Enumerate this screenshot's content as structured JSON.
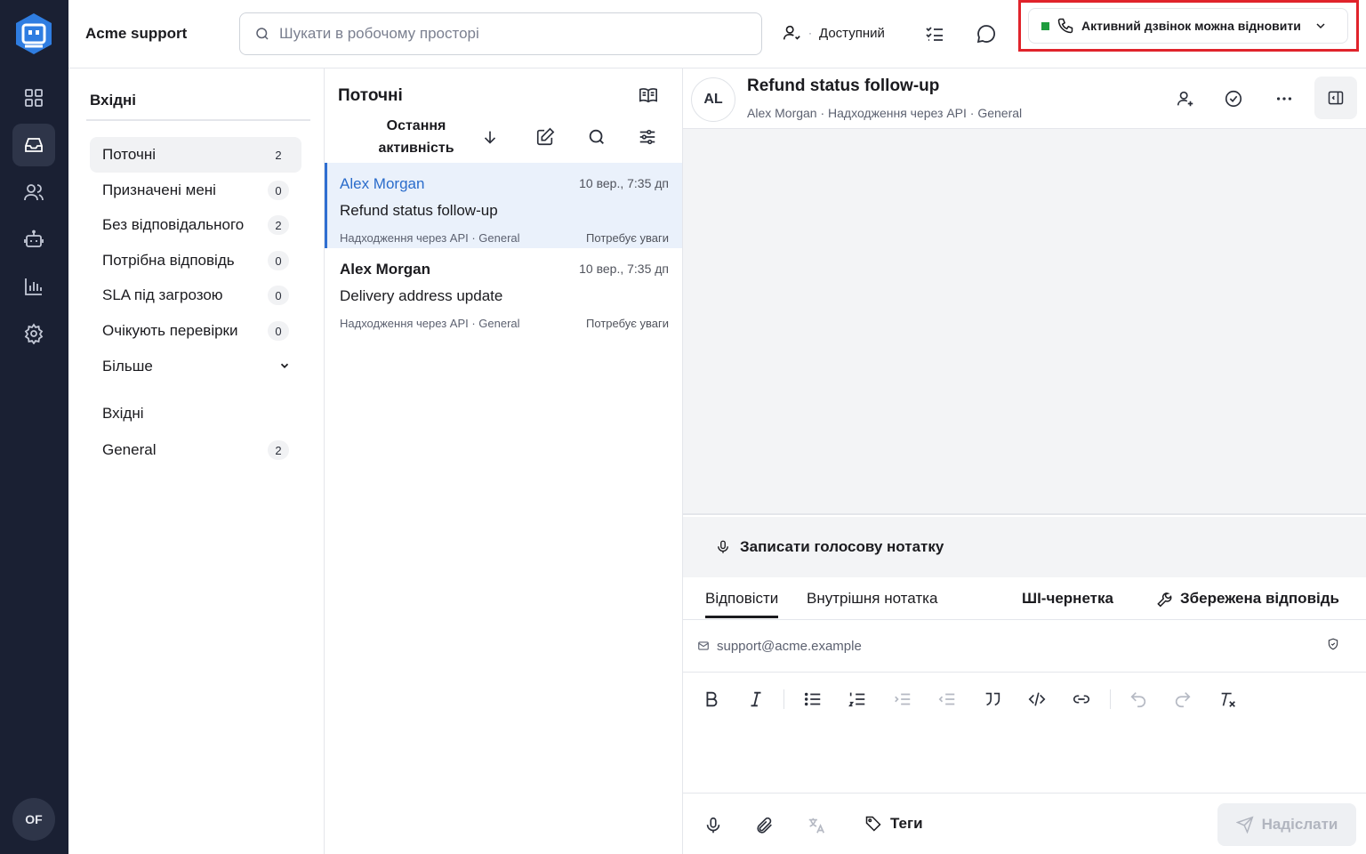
{
  "app": {
    "brand": "Acme support",
    "user_initials": "OF"
  },
  "rail": {
    "items": [
      "dashboard-icon",
      "inbox-icon",
      "contacts-icon",
      "bot-icon",
      "reports-icon",
      "settings-icon"
    ],
    "active": "inbox-icon"
  },
  "search": {
    "placeholder": "Шукати в робочому просторі"
  },
  "status": {
    "label": "Доступний"
  },
  "call": {
    "label": "Активний дзвінок можна відновити",
    "indicator_color": "#1e9c3e",
    "highlight_color": "#e0232b"
  },
  "sidebar": {
    "title": "Вхідні",
    "items": [
      {
        "label": "Поточні",
        "count": "2"
      },
      {
        "label": "Призначені мені",
        "count": "0"
      },
      {
        "label": "Без відповідального",
        "count": "2"
      },
      {
        "label": "Потрібна відповідь",
        "count": "0"
      },
      {
        "label": "SLA під загрозою",
        "count": "0"
      },
      {
        "label": "Очікують перевірки",
        "count": "0"
      }
    ],
    "more_label": "Більше",
    "inboxes_title": "Вхідні",
    "inboxes": [
      {
        "label": "General",
        "count": "2"
      }
    ]
  },
  "list": {
    "title": "Поточні",
    "sort_label": "Остання активність",
    "conversations": [
      {
        "name": "Alex Morgan",
        "time": "10 вер., 7:35 дп",
        "subject": "Refund status follow-up",
        "meta": "Надходження через API · General",
        "flag": "Потребує уваги"
      },
      {
        "name": "Alex Morgan",
        "time": "10 вер., 7:35 дп",
        "subject": "Delivery address update",
        "meta": "Надходження через API · General",
        "flag": "Потребує уваги"
      }
    ]
  },
  "conversation": {
    "initials": "AL",
    "title": "Refund status follow-up",
    "subtitle": "Alex Morgan  ·  Надходження через API  ·  General"
  },
  "composer": {
    "voice_note": "Записати голосову нотатку",
    "tabs": {
      "reply": "Відповісти",
      "note": "Внутрішня нотатка",
      "ai": "ШІ-чернетка",
      "saved": "Збережена відповідь"
    },
    "from": "support@acme.example",
    "tags_label": "Теги",
    "send_label": "Надіслати"
  }
}
